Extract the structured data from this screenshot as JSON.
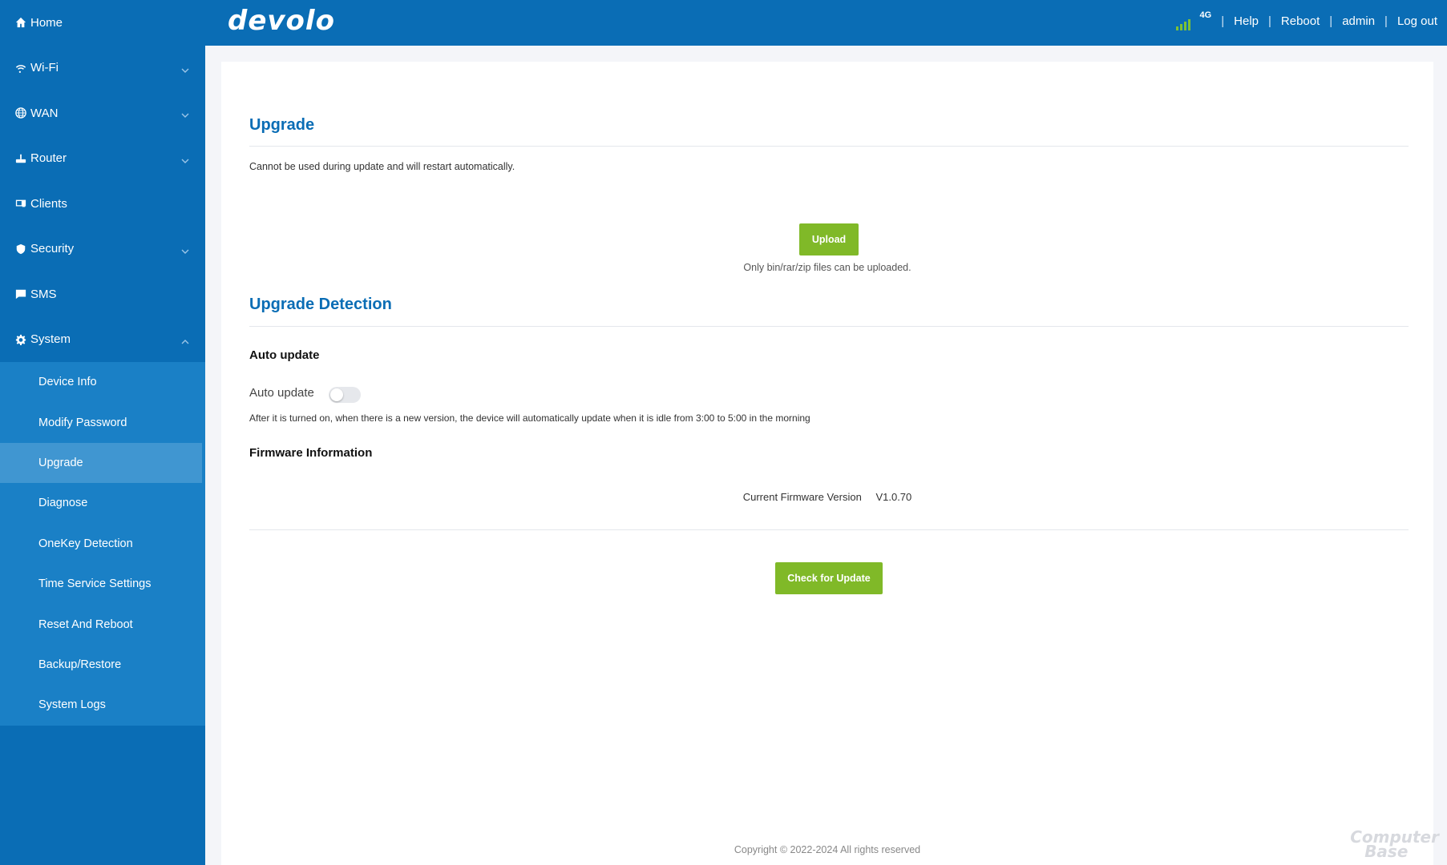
{
  "header": {
    "logo": "devolo",
    "network": "4G",
    "links": {
      "help": "Help",
      "reboot": "Reboot",
      "user": "admin",
      "logout": "Log out"
    },
    "separator": "|"
  },
  "sidebar": {
    "items": [
      {
        "label": "Home"
      },
      {
        "label": "Wi-Fi"
      },
      {
        "label": "WAN"
      },
      {
        "label": "Router"
      },
      {
        "label": "Clients"
      },
      {
        "label": "Security"
      },
      {
        "label": "SMS"
      },
      {
        "label": "System"
      }
    ],
    "system_submenu": [
      {
        "label": "Device Info"
      },
      {
        "label": "Modify Password"
      },
      {
        "label": "Upgrade"
      },
      {
        "label": "Diagnose"
      },
      {
        "label": "OneKey Detection"
      },
      {
        "label": "Time Service Settings"
      },
      {
        "label": "Reset And Reboot"
      },
      {
        "label": "Backup/Restore"
      },
      {
        "label": "System Logs"
      }
    ],
    "active_subitem": "Upgrade"
  },
  "upgrade": {
    "title": "Upgrade",
    "description": "Cannot be used during update and will restart automatically.",
    "upload_button": "Upload",
    "upload_hint": "Only bin/rar/zip files can be uploaded."
  },
  "detection": {
    "title": "Upgrade Detection",
    "auto_update_heading": "Auto update",
    "auto_update_label": "Auto update",
    "auto_update_enabled": false,
    "auto_update_note": "After it is turned on, when there is a new version, the device will automatically update when it is idle from 3:00 to 5:00 in the morning",
    "firmware_heading": "Firmware Information",
    "firmware_label": "Current Firmware Version",
    "firmware_value": "V1.0.70",
    "check_button": "Check for Update"
  },
  "footer": {
    "copyright": "Copyright © 2022-2024 All rights reserved"
  },
  "watermark": {
    "line1": "Computer",
    "line2": "Base"
  },
  "colors": {
    "brand_blue": "#0a6db5",
    "submenu_blue": "#1a80c6",
    "active_blue": "#4096d1",
    "action_green": "#80b928"
  }
}
